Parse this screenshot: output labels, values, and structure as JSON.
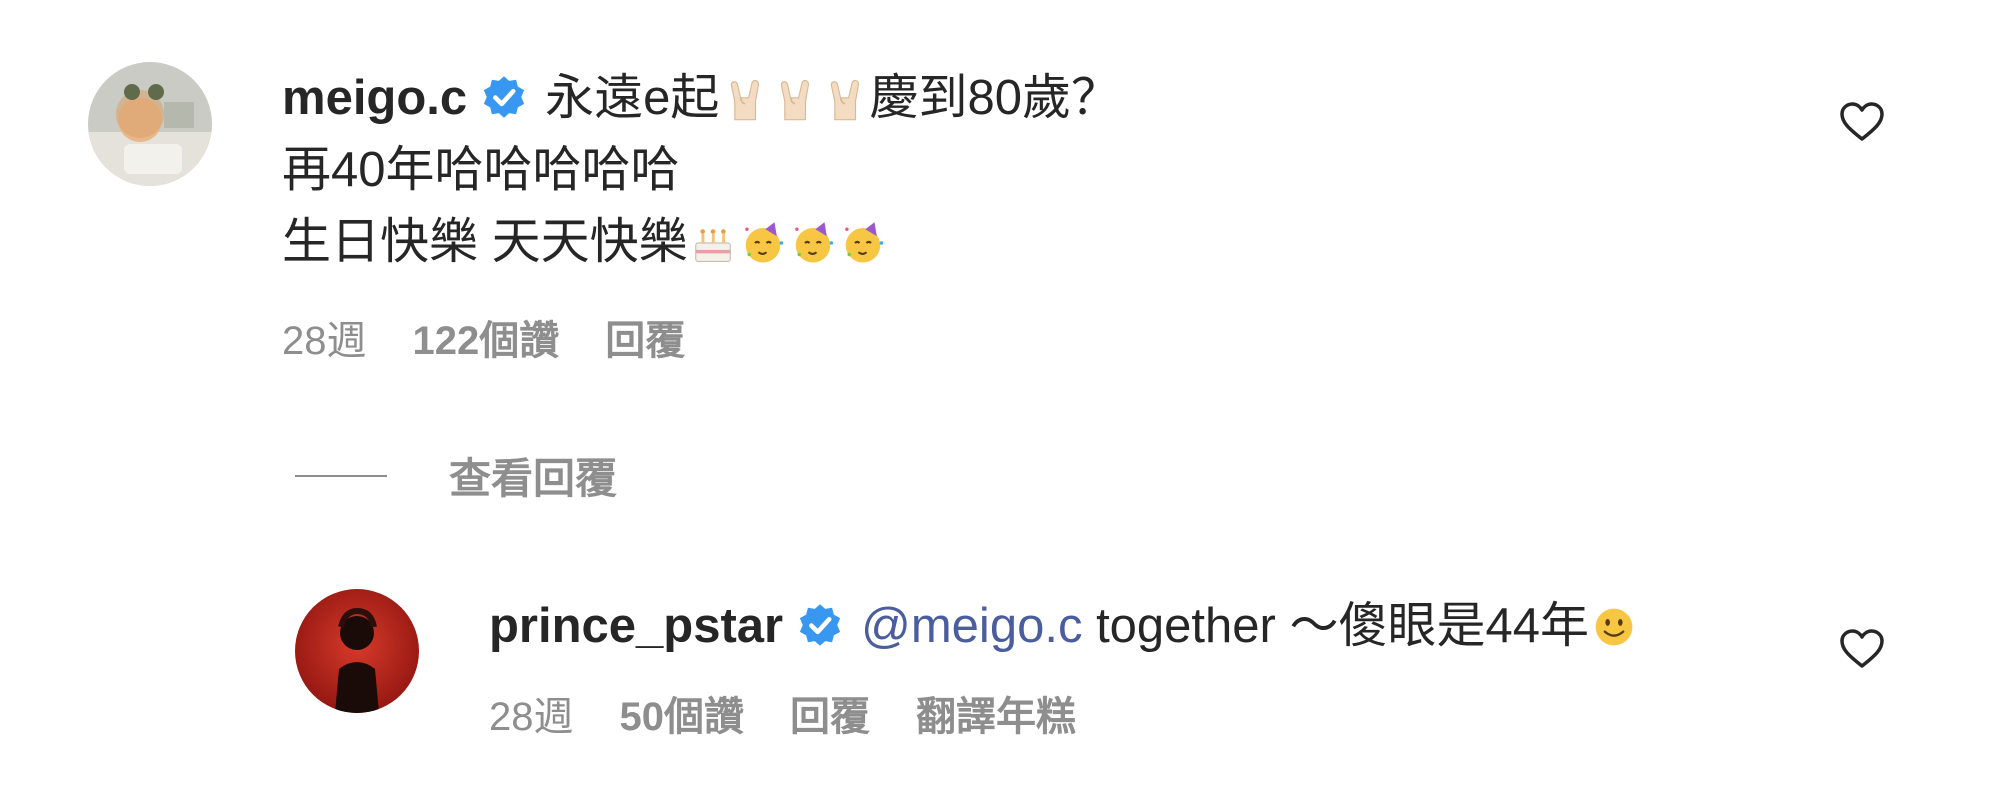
{
  "comment1": {
    "username": "meigo.c",
    "text_line1_a": "永遠e起",
    "text_line1_b": "慶到80歲？",
    "text_line2": "再40年哈哈哈哈哈",
    "text_line3": "生日快樂 天天快樂",
    "emoji_line1": [
      "rock-on-hand-emoji",
      "rock-on-hand-emoji",
      "rock-on-hand-emoji"
    ],
    "emoji_line3": [
      "birthday-cake-emoji",
      "partying-face-emoji",
      "partying-face-emoji",
      "partying-face-emoji"
    ],
    "time": "28週",
    "likes": "122個讚",
    "reply": "回覆"
  },
  "view_replies": {
    "label": "查看回覆"
  },
  "comment2": {
    "username": "prince_pstar",
    "mention": "@meigo.c",
    "text": " together ～傻眼是44年",
    "emoji": "slightly-smiling-face-emoji",
    "time": "28週",
    "likes": "50個讚",
    "reply": "回覆",
    "translate": "翻譯年糕"
  },
  "colors": {
    "text": "#262626",
    "secondary": "#8e8e8e",
    "verified_blue": "#3897f0",
    "mention": "#4a5d9e"
  }
}
